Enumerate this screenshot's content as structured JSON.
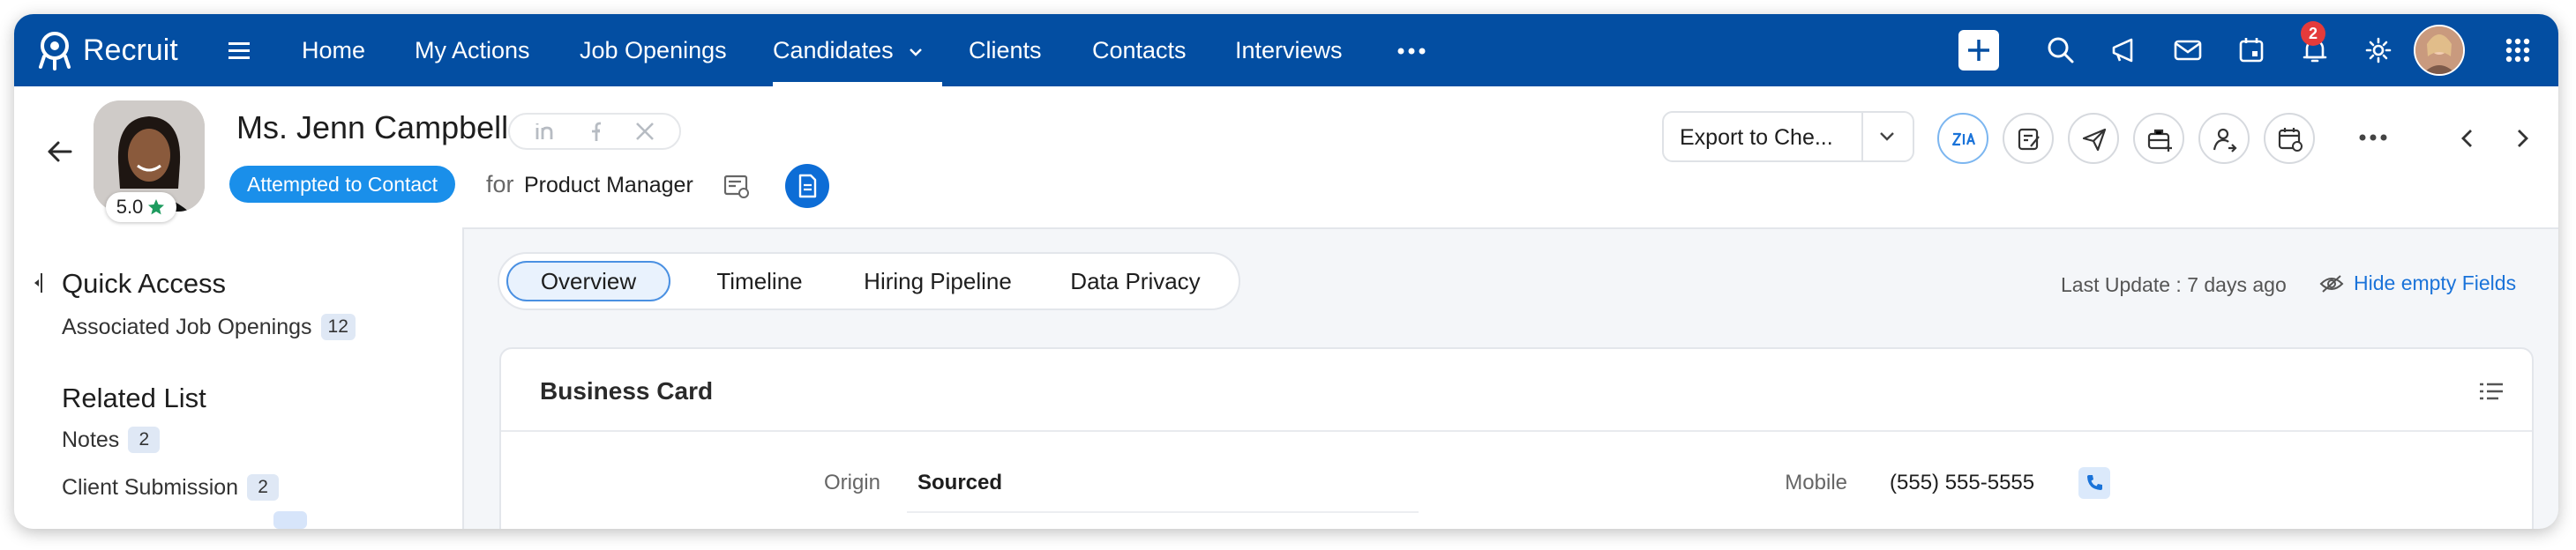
{
  "app": {
    "name": "Recruit"
  },
  "nav": {
    "items": [
      {
        "label": "Home"
      },
      {
        "label": "My Actions"
      },
      {
        "label": "Job Openings"
      },
      {
        "label": "Candidates"
      },
      {
        "label": "Clients"
      },
      {
        "label": "Contacts"
      },
      {
        "label": "Interviews"
      }
    ],
    "active": "Candidates",
    "notification_count": "2"
  },
  "record": {
    "name": "Ms. Jenn Campbell",
    "rating": "5.0",
    "status": "Attempted to Contact",
    "for_label": "for",
    "job_title": "Product Manager",
    "export_label": "Export to Che...",
    "social_icons": [
      "linkedin-icon",
      "facebook-icon",
      "x-icon"
    ]
  },
  "sidebar": {
    "quick_access_title": "Quick Access",
    "quick_access_items": [
      {
        "label": "Associated Job Openings",
        "count": "12"
      }
    ],
    "related_title": "Related List",
    "related_items": [
      {
        "label": "Notes",
        "count": "2"
      },
      {
        "label": "Client Submission",
        "count": "2"
      }
    ]
  },
  "tabs": [
    {
      "label": "Overview"
    },
    {
      "label": "Timeline"
    },
    {
      "label": "Hiring Pipeline"
    },
    {
      "label": "Data Privacy"
    }
  ],
  "meta": {
    "last_update": "Last Update : 7 days ago",
    "hide_empty": "Hide empty Fields"
  },
  "card": {
    "title": "Business Card",
    "fields": [
      {
        "label": "Origin",
        "value": "Sourced"
      },
      {
        "label": "Mobile",
        "value": "(555) 555-5555"
      }
    ]
  },
  "colors": {
    "brand": "#034ea2",
    "status": "#1a8fea",
    "link": "#1a73d9"
  }
}
